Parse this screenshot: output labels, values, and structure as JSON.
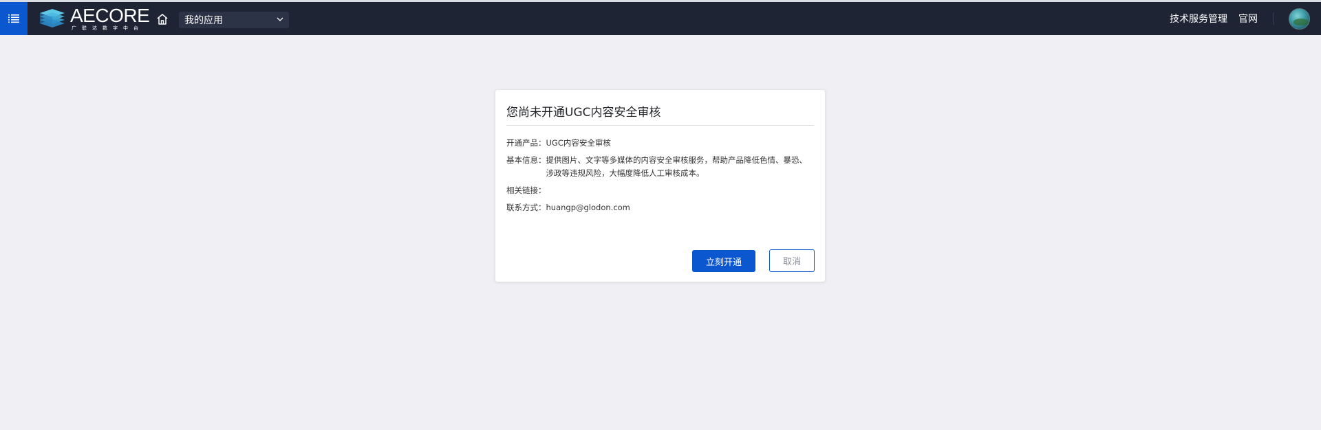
{
  "header": {
    "logo_text": "AECORE",
    "logo_subtitle": "广联达数字中台",
    "app_select_value": "我的应用",
    "nav_links": [
      "技术服务管理",
      "官网"
    ]
  },
  "dialog": {
    "title": "您尚未开通UGC内容安全审核",
    "rows": [
      {
        "label": "开通产品：",
        "value": "UGC内容安全审核"
      },
      {
        "label": "基本信息：",
        "value": "提供图片、文字等多媒体的内容安全审核服务，帮助产品降低色情、暴恐、涉政等违规风险，大幅度降低人工审核成本。"
      },
      {
        "label": "相关链接：",
        "value": ""
      },
      {
        "label": "联系方式：",
        "value": "huangp@glodon.com"
      }
    ],
    "confirm_label": "立刻开通",
    "cancel_label": "取消"
  },
  "colors": {
    "topbar": "#1f2435",
    "accent": "#0b57d0",
    "page_bg": "#f0f0f4"
  },
  "icons": [
    "menu-list-icon",
    "aecore-logo-icon",
    "home-icon",
    "chevron-down-icon",
    "user-avatar"
  ]
}
